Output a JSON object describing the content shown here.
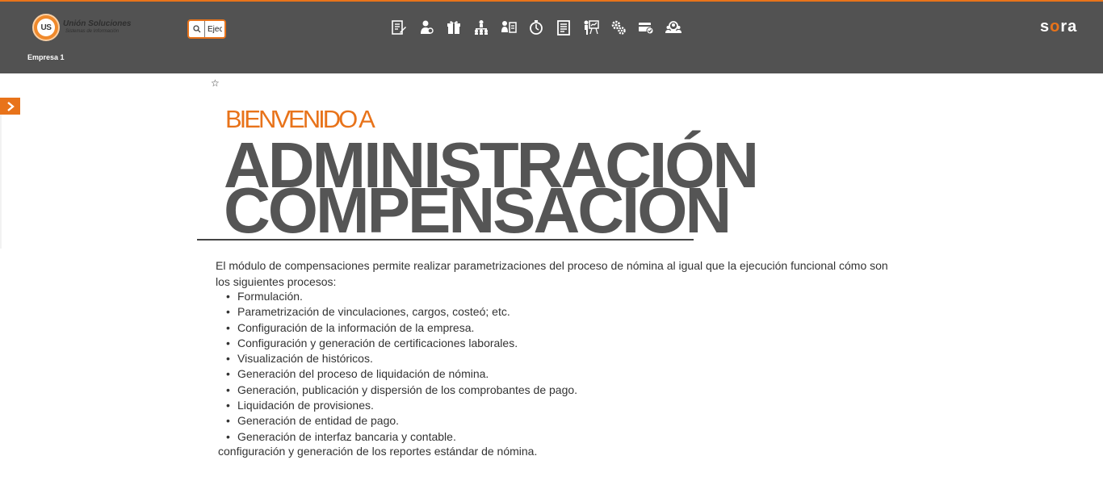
{
  "header": {
    "logo_title": "Unión Soluciones",
    "logo_subtitle": "Sistemas de Información",
    "logo_mark": "US",
    "company": "Empresa 1",
    "search": {
      "value": "Ejec",
      "icon": "search-icon"
    },
    "modules": [
      {
        "name": "module-formulacion-icon"
      },
      {
        "name": "module-empleados-icon"
      },
      {
        "name": "module-beneficios-icon"
      },
      {
        "name": "module-organigrama-icon"
      },
      {
        "name": "module-vinculacion-icon"
      },
      {
        "name": "module-tiempos-icon"
      },
      {
        "name": "module-documentos-icon"
      },
      {
        "name": "module-capacitacion-icon"
      },
      {
        "name": "module-configuracion-icon"
      },
      {
        "name": "module-pagos-icon"
      },
      {
        "name": "module-usuarios-icon"
      }
    ],
    "brand": "sora",
    "colors": {
      "header_bg": "#525252",
      "accent": "#e8731a"
    }
  },
  "favorite_icon": "☆",
  "sidebar_toggle_icon": "chevron-right-icon",
  "main": {
    "welcome": "BIENVENIDO A",
    "title_line1": "ADMINISTRACIÓN",
    "title_line2": "COMPENSACION",
    "intro": "El módulo de compensaciones permite realizar parametrizaciones del proceso de nómina al igual que la ejecución funcional cómo son los siguientes procesos:",
    "processes": [
      "Formulación.",
      "Parametrización de vinculaciones, cargos, costeó; etc.",
      "Configuración de la información de la empresa.",
      "Configuración y generación de certificaciones laborales.",
      "Visualización de históricos.",
      "Generación del proceso de liquidación de nómina.",
      "Generación, publicación y dispersión de los comprobantes de pago.",
      "Liquidación de provisiones.",
      "Generación de entidad de pago.",
      "Generación de interfaz bancaria y contable."
    ],
    "footer": "configuración y generación de los reportes estándar de nómina."
  }
}
